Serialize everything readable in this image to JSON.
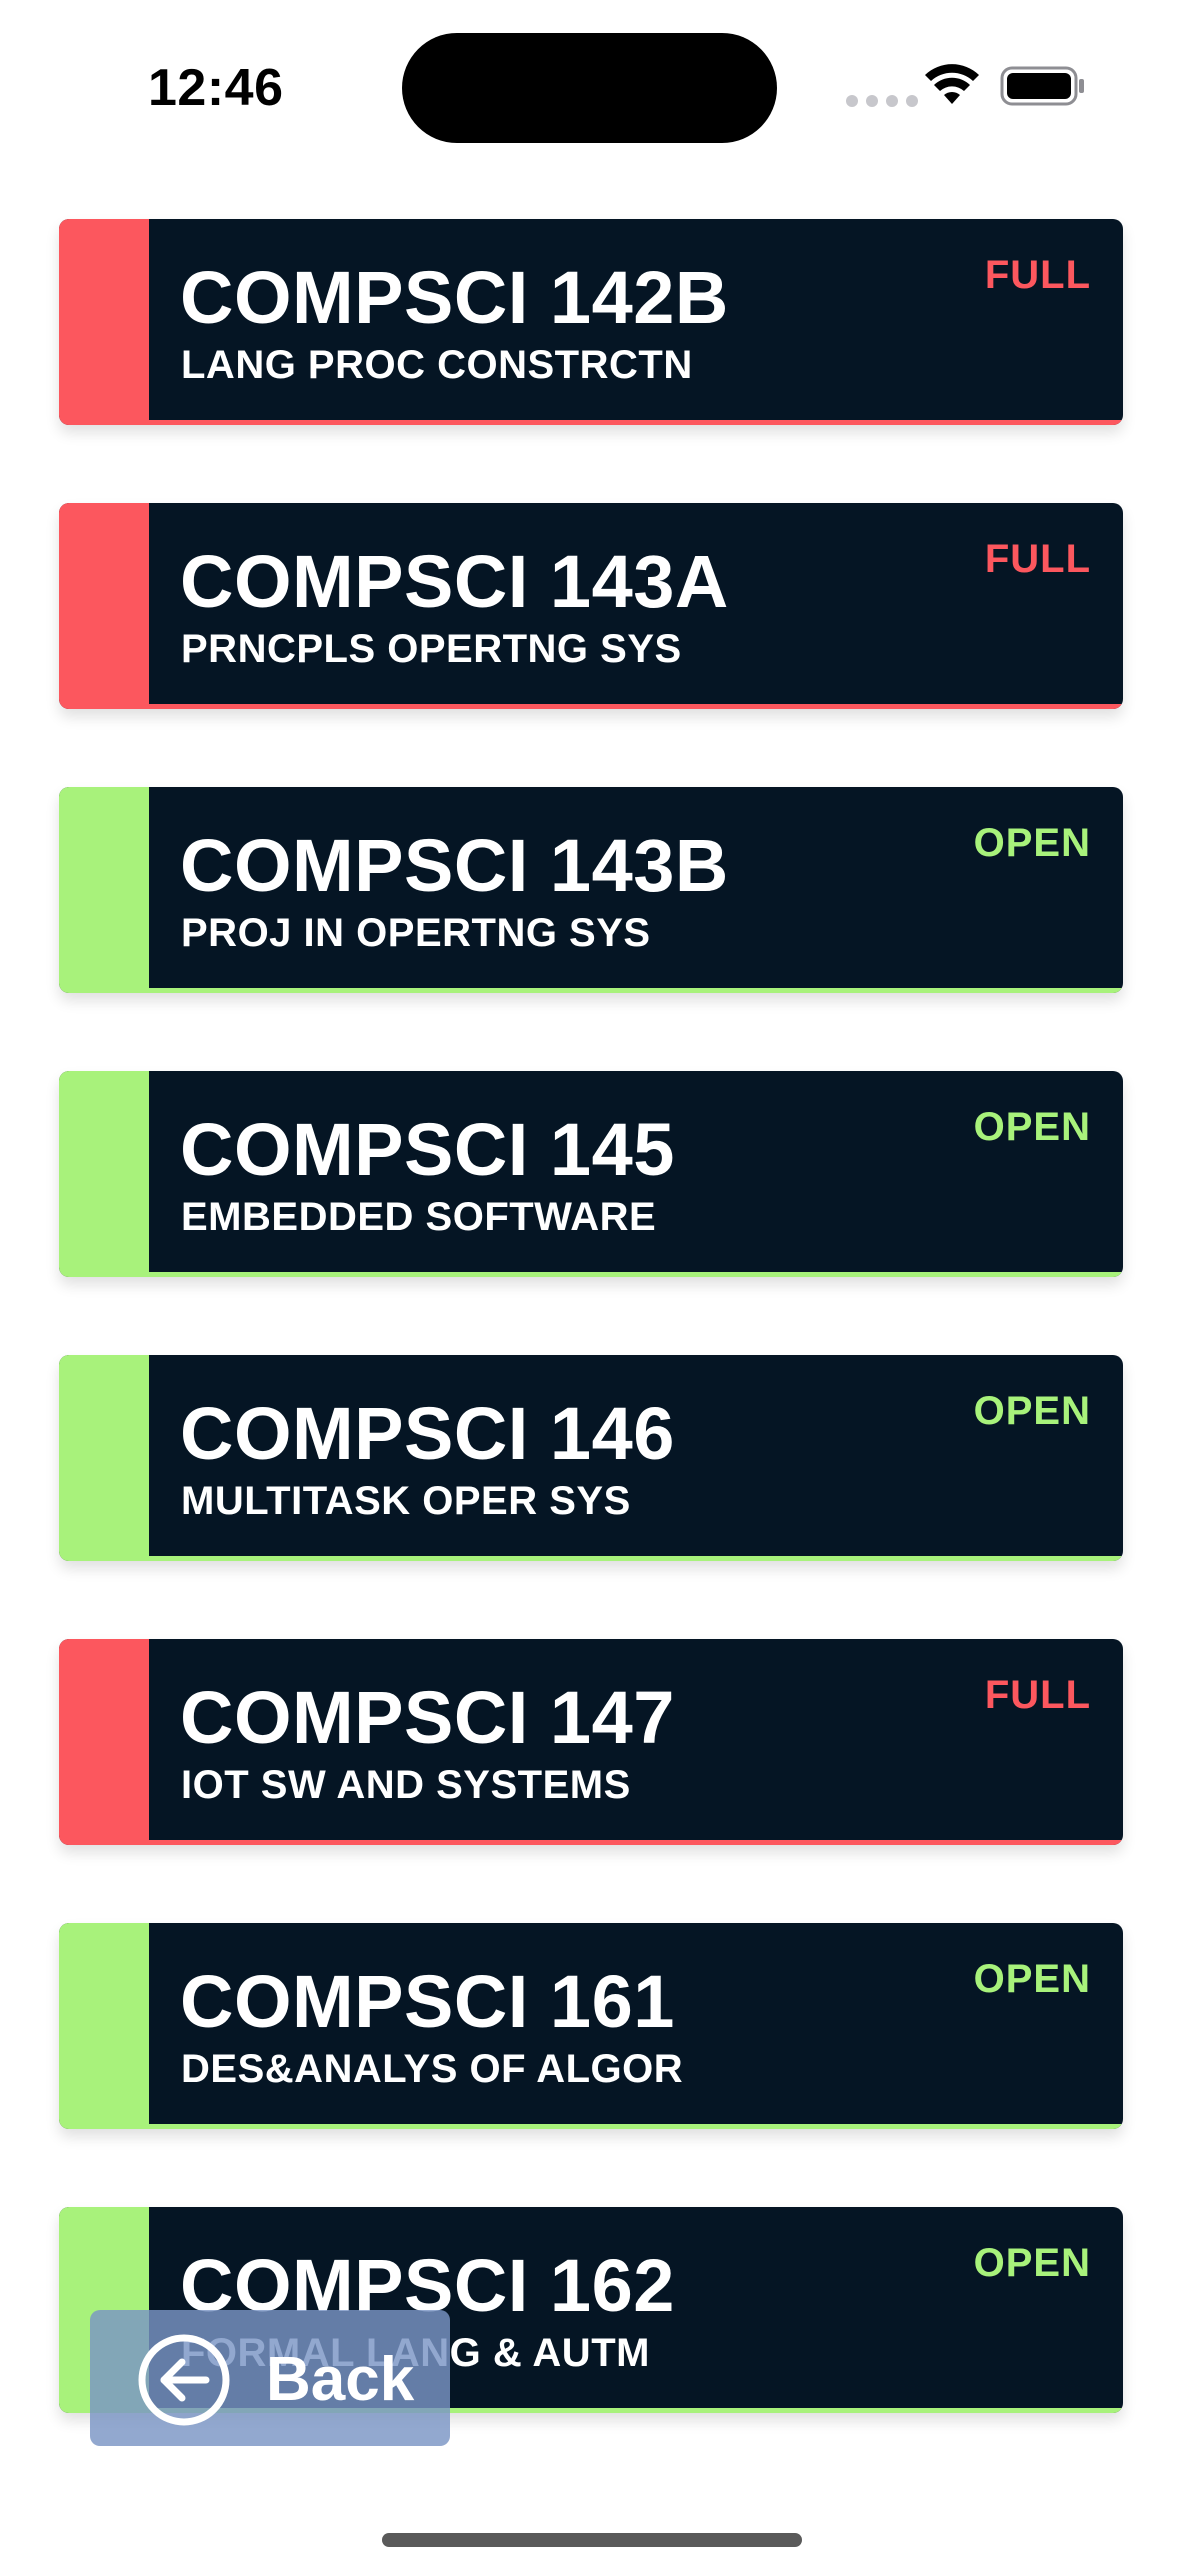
{
  "status_bar": {
    "time": "12:46"
  },
  "colors": {
    "full": "#fc575e",
    "open": "#a8f27b",
    "card_bg": "#051524"
  },
  "courses": [
    {
      "code": "COMPSCI 142B",
      "title": "LANG PROC CONSTRCTN",
      "status": "FULL"
    },
    {
      "code": "COMPSCI 143A",
      "title": "PRNCPLS OPERTNG SYS",
      "status": "FULL"
    },
    {
      "code": "COMPSCI 143B",
      "title": "PROJ IN OPERTNG SYS",
      "status": "OPEN"
    },
    {
      "code": "COMPSCI 145",
      "title": "EMBEDDED SOFTWARE",
      "status": "OPEN"
    },
    {
      "code": "COMPSCI 146",
      "title": "MULTITASK OPER SYS",
      "status": "OPEN"
    },
    {
      "code": "COMPSCI 147",
      "title": "IOT SW AND SYSTEMS",
      "status": "FULL"
    },
    {
      "code": "COMPSCI 161",
      "title": "DES&ANALYS OF ALGOR",
      "status": "OPEN"
    },
    {
      "code": "COMPSCI 162",
      "title": "FORMAL LANG & AUTM",
      "status": "OPEN"
    }
  ],
  "back_button": {
    "label": "Back"
  }
}
